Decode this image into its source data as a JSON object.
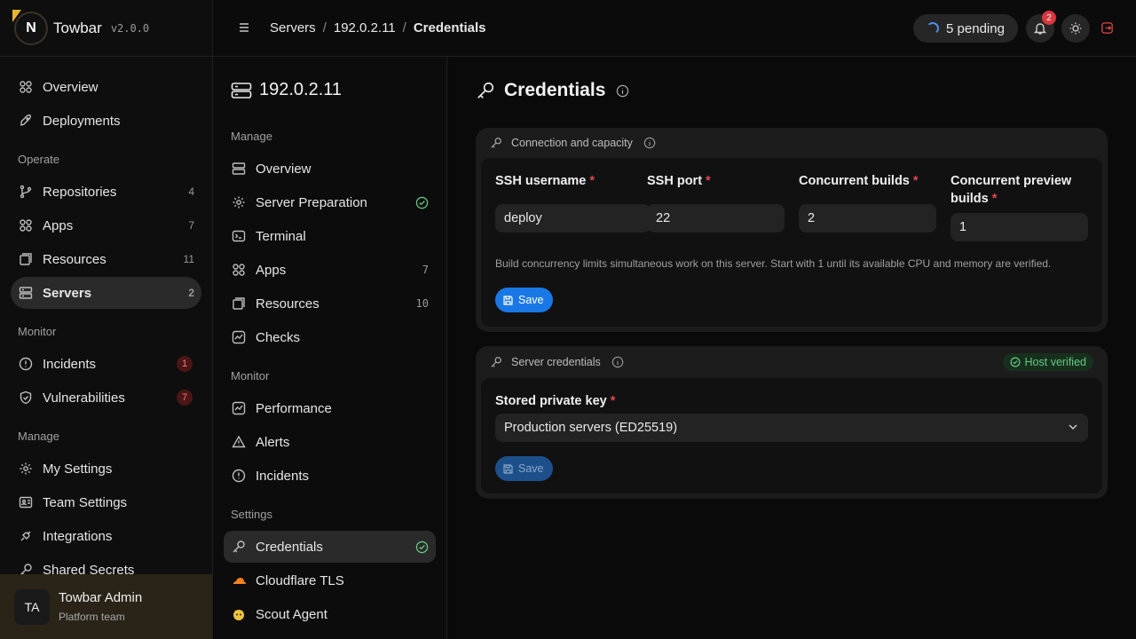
{
  "app": {
    "name": "Towbar",
    "version": "v2.0.0",
    "logo_letter": "N"
  },
  "sidebar": {
    "items": [
      {
        "label": "Overview",
        "icon": "grid-icon"
      },
      {
        "label": "Deployments",
        "icon": "rocket-icon"
      }
    ],
    "sections": [
      {
        "title": "Operate",
        "items": [
          {
            "label": "Repositories",
            "icon": "git-branch-icon",
            "count": "4"
          },
          {
            "label": "Apps",
            "icon": "grid-icon",
            "count": "7"
          },
          {
            "label": "Resources",
            "icon": "box-icon",
            "count": "11"
          },
          {
            "label": "Servers",
            "icon": "server-icon",
            "count": "2"
          }
        ]
      },
      {
        "title": "Monitor",
        "items": [
          {
            "label": "Incidents",
            "icon": "alert-circle-icon",
            "count": "1"
          },
          {
            "label": "Vulnerabilities",
            "icon": "shield-icon",
            "count": "7"
          }
        ]
      },
      {
        "title": "Manage",
        "items": [
          {
            "label": "My Settings",
            "icon": "gear-icon"
          },
          {
            "label": "Team Settings",
            "icon": "team-icon"
          },
          {
            "label": "Integrations",
            "icon": "plug-icon"
          },
          {
            "label": "Shared Secrets",
            "icon": "key-icon"
          }
        ]
      }
    ],
    "user": {
      "initials": "TA",
      "name": "Towbar Admin",
      "team": "Platform team"
    }
  },
  "topbar": {
    "breadcrumbs": [
      "Servers",
      "192.0.2.11",
      "Credentials"
    ],
    "separator": "/",
    "pending": "5 pending",
    "notifications": "2"
  },
  "subnav": {
    "server": "192.0.2.11",
    "sections": [
      {
        "title": "Manage",
        "items": [
          {
            "label": "Overview",
            "icon": "server-icon"
          },
          {
            "label": "Server Preparation",
            "icon": "gear-icon",
            "status": "ok"
          },
          {
            "label": "Terminal",
            "icon": "terminal-icon"
          },
          {
            "label": "Apps",
            "icon": "grid-icon",
            "count": "7"
          },
          {
            "label": "Resources",
            "icon": "box-icon",
            "count": "10"
          },
          {
            "label": "Checks",
            "icon": "chart-icon"
          }
        ]
      },
      {
        "title": "Monitor",
        "items": [
          {
            "label": "Performance",
            "icon": "chart-icon"
          },
          {
            "label": "Alerts",
            "icon": "warning-icon"
          },
          {
            "label": "Incidents",
            "icon": "alert-circle-icon"
          }
        ]
      },
      {
        "title": "Settings",
        "items": [
          {
            "label": "Credentials",
            "icon": "key-icon",
            "status": "ok"
          },
          {
            "label": "Cloudflare TLS",
            "icon": "cloud-icon"
          },
          {
            "label": "Scout Agent",
            "icon": "agent-icon"
          }
        ]
      }
    ]
  },
  "main": {
    "title": "Credentials",
    "connection": {
      "title": "Connection and capacity",
      "fields": [
        {
          "label": "SSH username",
          "value": "deploy"
        },
        {
          "label": "SSH port",
          "value": "22"
        },
        {
          "label": "Concurrent builds",
          "value": "2"
        },
        {
          "label": "Concurrent preview builds",
          "value": "1"
        }
      ],
      "required_mark": "*",
      "hint": "Build concurrency limits simultaneous work on this server. Start with 1 until its available CPU and memory are verified.",
      "save": "Save"
    },
    "credentials": {
      "title": "Server credentials",
      "verified": "Host verified",
      "key_label": "Stored private key",
      "key_value": "Production servers (ED25519)",
      "save": "Save"
    }
  },
  "colors": {
    "accent": "#1a78e6",
    "danger": "#e0474c",
    "success": "#67c785",
    "brand": "#e8b532"
  }
}
